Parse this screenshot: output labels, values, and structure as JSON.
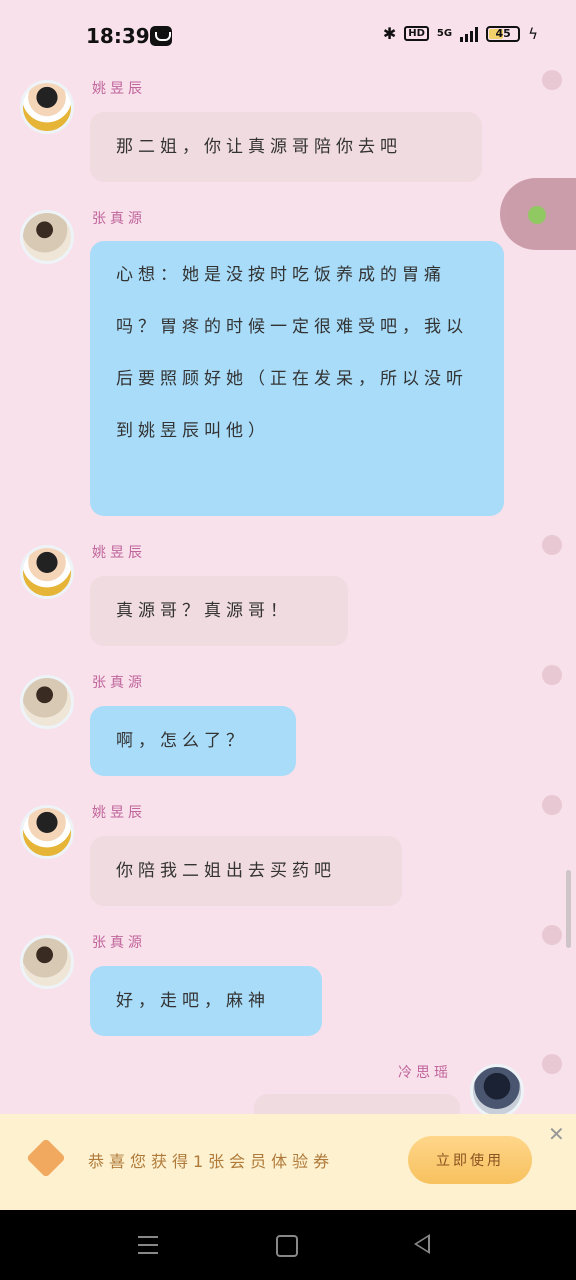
{
  "status_bar": {
    "time": "18:39",
    "network": "5G",
    "hd": "HD",
    "battery": "45",
    "battery_level": 0.45
  },
  "messages": [
    {
      "sender": "姚昱辰",
      "text": "那二姐，你让真源哥陪你去吧"
    },
    {
      "sender": "张真源",
      "text": "心想：她是没按时吃饭养成的胃痛吗？胃疼的时候一定很难受吧，我以后要照顾好她（正在发呆，所以没听到姚昱辰叫他）"
    },
    {
      "sender": "姚昱辰",
      "text": "真源哥？真源哥！"
    },
    {
      "sender": "张真源",
      "text": "啊，怎么了？"
    },
    {
      "sender": "姚昱辰",
      "text": "你陪我二姐出去买药吧"
    },
    {
      "sender": "张真源",
      "text": "好，走吧，麻神"
    },
    {
      "sender": "冷思瑶",
      "text": ""
    }
  ],
  "banner": {
    "text": "恭喜您获得1张会员体验券",
    "button": "立即使用"
  },
  "colors": {
    "background": "#f8e1ea",
    "bubble_gray": "#f0dbe0",
    "bubble_blue": "#a8dcf9",
    "name": "#c0649c"
  }
}
